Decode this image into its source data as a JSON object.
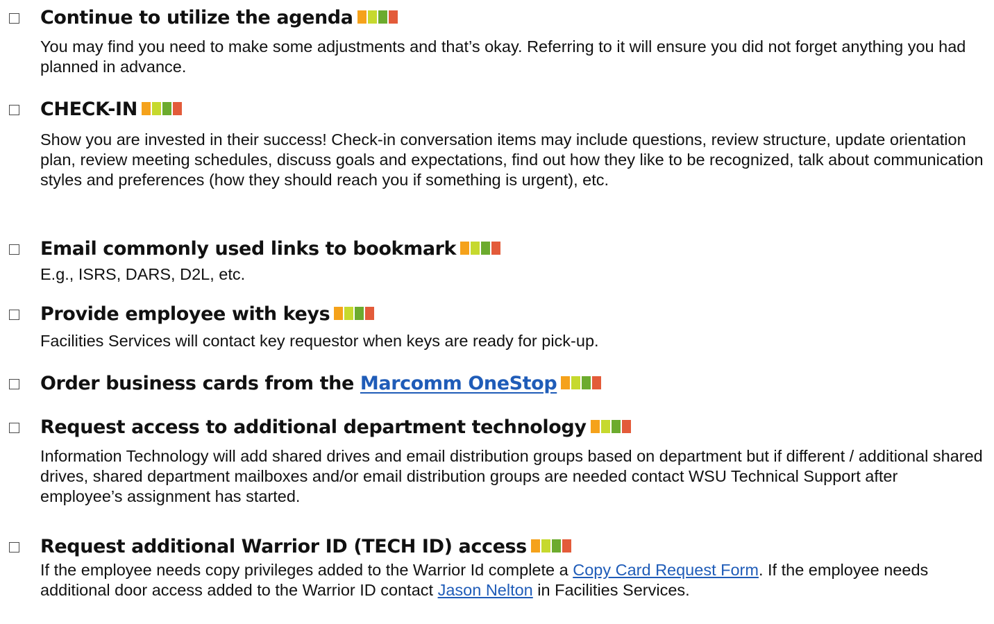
{
  "colors": {
    "bar_orange": "#f5a21b",
    "bar_lime": "#c6d92e",
    "bar_green": "#6cab2e",
    "bar_red": "#e35b3a",
    "link": "#1f5cb8"
  },
  "items": [
    {
      "title": "Continue to utilize the agenda",
      "desc": "You may find you need to make some adjustments and that’s okay. Referring to it will ensure you did not forget anything you had planned in advance."
    },
    {
      "title": "CHECK-IN",
      "desc": "Show you are invested in their success! Check-in conversation items may include questions, review structure, update orientation plan, review meeting schedules, discuss goals and expectations, find out how they like to be recognized, talk about communication styles and preferences (how they should reach you if something is urgent), etc."
    },
    {
      "title": "Email commonly used links to bookmark",
      "desc": "E.g., ISRS, DARS, D2L, etc."
    },
    {
      "title": "Provide employee with keys",
      "desc": "Facilities Services will contact key requestor when keys are ready for pick-up."
    },
    {
      "title_prefix": "Order business cards from the ",
      "title_link": "Marcomm OneStop"
    },
    {
      "title": "Request access to additional department technology",
      "desc": "Information Technology will add shared drives and email distribution groups based on department but if different / additional shared drives, shared department mailboxes and/or email distribution groups are needed contact WSU Technical Support after employee’s assignment has started."
    },
    {
      "title": "Request additional Warrior ID (TECH ID) access",
      "desc_part1": "If the employee needs copy privileges added to the Warrior Id complete a ",
      "desc_link1": "Copy Card Request Form",
      "desc_part2": ". If the employee needs additional door access added to the Warrior ID contact ",
      "desc_link2": "Jason Nelton",
      "desc_part3": " in Facilities Services."
    }
  ]
}
